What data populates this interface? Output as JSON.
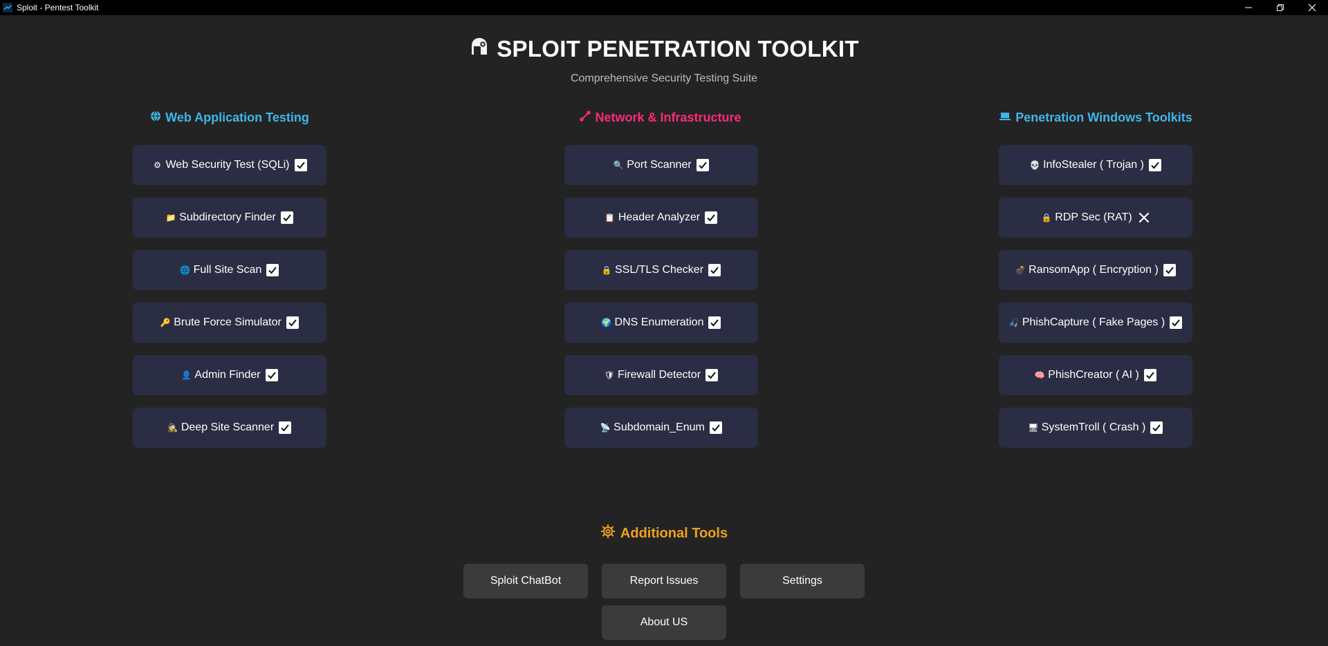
{
  "window": {
    "title": "Sploit - Pentest Toolkit",
    "controls": {
      "minimize": "—",
      "restore": "❐",
      "close": "✕"
    }
  },
  "header": {
    "title": "SPLOIT PENETRATION TOOLKIT",
    "subtitle": "Comprehensive Security Testing Suite"
  },
  "colors": {
    "web_heading": "#3fb6e8",
    "network_heading": "#ff2a7a",
    "windows_heading": "#3fb6e8",
    "additional_heading": "#f0a020",
    "tool_button_bg": "#2b2d44"
  },
  "sections": {
    "web": {
      "title": "Web Application Testing",
      "icon": "globe-icon",
      "items": [
        {
          "label": "Web Security Test (SQLi)",
          "icon": "gear-icon",
          "status": "available"
        },
        {
          "label": "Subdirectory Finder",
          "icon": "folder-icon",
          "status": "available"
        },
        {
          "label": "Full Site Scan",
          "icon": "globe-icon",
          "status": "available"
        },
        {
          "label": "Brute Force Simulator",
          "icon": "key-icon",
          "status": "available"
        },
        {
          "label": "Admin Finder",
          "icon": "user-icon",
          "status": "available"
        },
        {
          "label": "Deep Site Scanner",
          "icon": "spy-icon",
          "status": "available"
        }
      ]
    },
    "network": {
      "title": "Network & Infrastructure",
      "icon": "link-icon",
      "items": [
        {
          "label": "Port Scanner",
          "icon": "magnifier-icon",
          "status": "available"
        },
        {
          "label": "Header Analyzer",
          "icon": "clipboard-icon",
          "status": "available"
        },
        {
          "label": "SSL/TLS Checker",
          "icon": "lock-icon",
          "status": "available"
        },
        {
          "label": "DNS Enumeration",
          "icon": "earth-icon",
          "status": "available"
        },
        {
          "label": "Firewall Detector",
          "icon": "shield-icon",
          "status": "available"
        },
        {
          "label": "Subdomain_Enum",
          "icon": "satellite-icon",
          "status": "available"
        }
      ]
    },
    "windows": {
      "title": "Penetration Windows Toolkits",
      "icon": "laptop-icon",
      "items": [
        {
          "label": "InfoStealer ( Trojan )",
          "icon": "skull-icon",
          "status": "available"
        },
        {
          "label": "RDP Sec (RAT)",
          "icon": "lock-icon",
          "status": "unavailable"
        },
        {
          "label": "RansomApp ( Encryption )",
          "icon": "bomb-icon",
          "status": "available"
        },
        {
          "label": "PhishCapture ( Fake Pages )",
          "icon": "hook-icon",
          "status": "available"
        },
        {
          "label": "PhishCreator ( AI )",
          "icon": "brain-icon",
          "status": "available"
        },
        {
          "label": "SystemTroll ( Crash )",
          "icon": "monitor-icon",
          "status": "available"
        }
      ]
    }
  },
  "additional": {
    "title": "Additional Tools",
    "icon": "settings-gear-icon",
    "buttons": {
      "chatbot": "Sploit ChatBot",
      "report": "Report Issues",
      "settings": "Settings",
      "about": "About US"
    }
  }
}
